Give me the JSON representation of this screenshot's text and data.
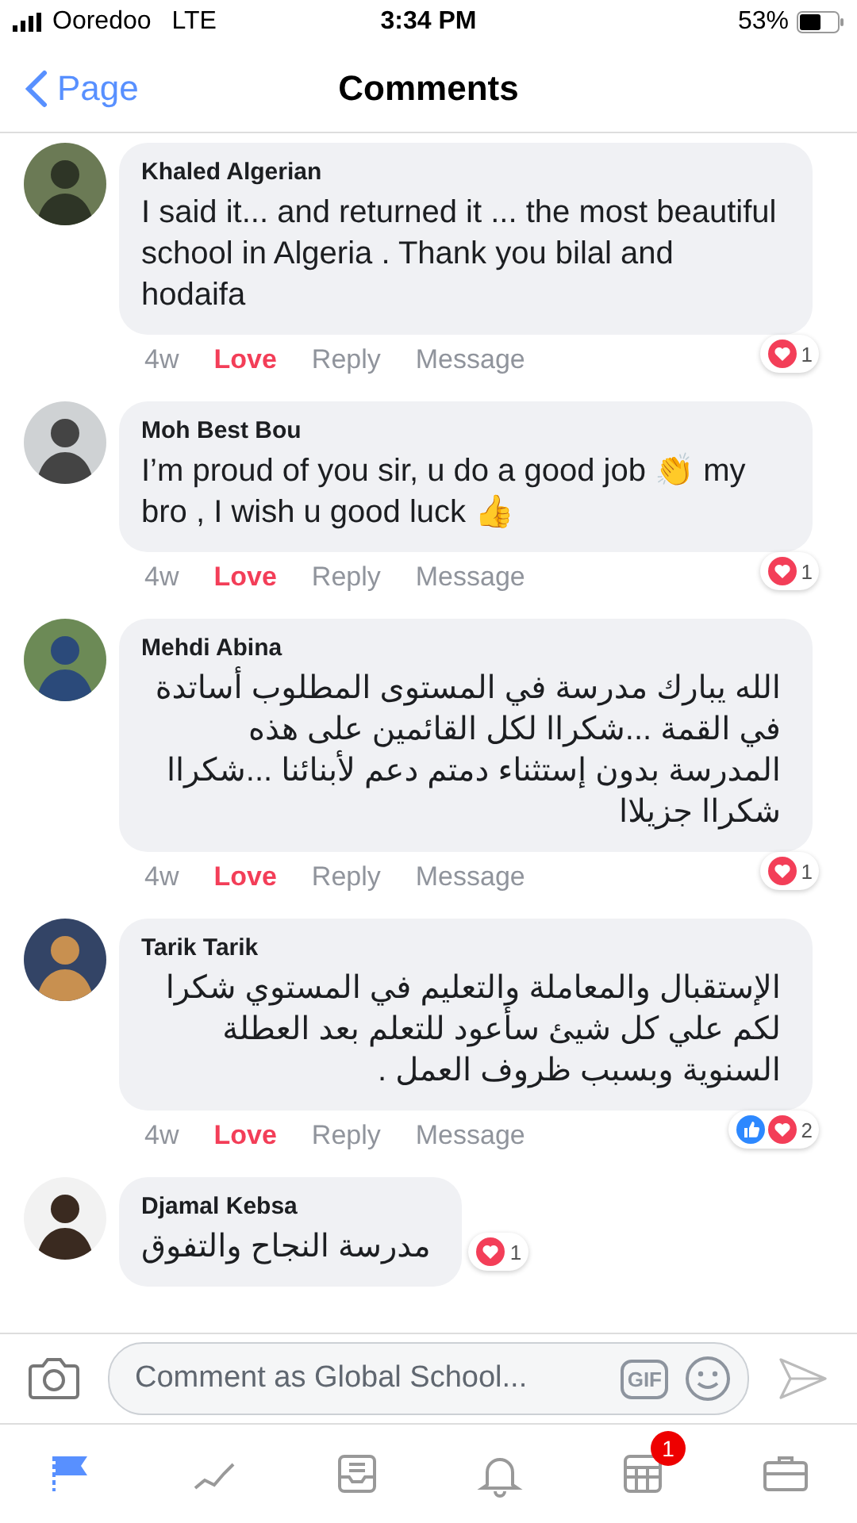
{
  "status_bar": {
    "carrier": "Ooredoo",
    "network": "LTE",
    "time": "3:34 PM",
    "battery": "53%"
  },
  "nav": {
    "back": "Page",
    "title": "Comments"
  },
  "comments": [
    {
      "author": "Khaled Algerian",
      "text": "I said it... and returned it  ...  the most beautiful school in Algeria . Thank you bilal and hodaifa",
      "rtl": false,
      "age": "4w",
      "love": "Love",
      "loved": true,
      "reply": "Reply",
      "message": "Message",
      "reactions": [
        {
          "kind": "love"
        }
      ],
      "reaction_count": "1"
    },
    {
      "author": "Moh Best Bou",
      "text": "I’m proud of you sir, u do a good job 👏 my bro , I wish u good luck 👍",
      "rtl": false,
      "age": "4w",
      "love": "Love",
      "loved": true,
      "reply": "Reply",
      "message": "Message",
      "reactions": [
        {
          "kind": "love"
        }
      ],
      "reaction_count": "1"
    },
    {
      "author": "Mehdi Abina",
      "text": "الله يبارك مدرسة في المستوى المطلوب أساتدة في القمة ...شكراا لكل القائمين على هذه المدرسة بدون إستثناء دمتم دعم لأبنائنا ...شكراا شكراا جزيلاا",
      "rtl": true,
      "age": "4w",
      "love": "Love",
      "loved": true,
      "reply": "Reply",
      "message": "Message",
      "reactions": [
        {
          "kind": "love"
        }
      ],
      "reaction_count": "1"
    },
    {
      "author": "Tarik Tarik",
      "text": "الإستقبال والمعاملة والتعليم في المستوي شكرا لكم علي كل شيئ سأعود للتعلم بعد العطلة السنوية وبسبب ظروف العمل .",
      "rtl": true,
      "age": "4w",
      "love": "Love",
      "loved": true,
      "reply": "Reply",
      "message": "Message",
      "reactions": [
        {
          "kind": "like"
        },
        {
          "kind": "love"
        }
      ],
      "reaction_count": "2"
    },
    {
      "author": "Djamal Kebsa",
      "text": "مدرسة النجاح والتفوق",
      "reactions": [
        {
          "kind": "love"
        }
      ],
      "reaction_count": "1"
    }
  ],
  "composer": {
    "placeholder": "Comment as Global School...",
    "gif": "GIF"
  },
  "tabs": [
    {
      "selected": true
    },
    {
      "selected": false
    },
    {
      "selected": false
    },
    {
      "selected": false
    },
    {
      "selected": false,
      "badge": "1"
    },
    {
      "selected": false
    }
  ]
}
